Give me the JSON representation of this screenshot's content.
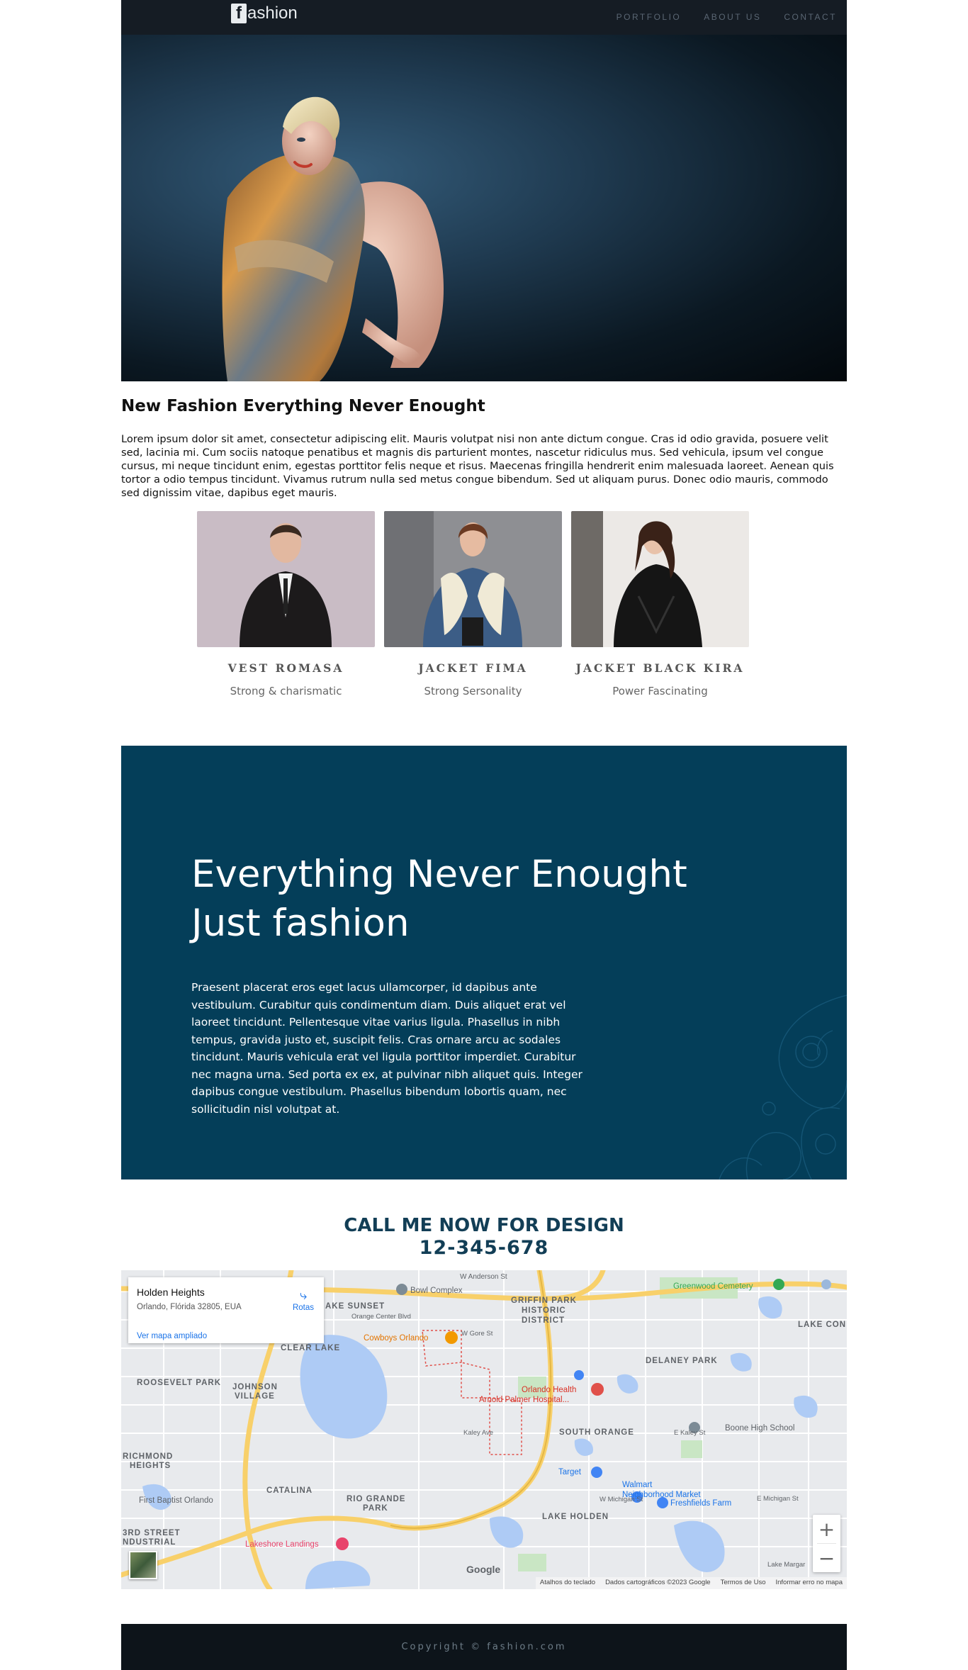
{
  "header": {
    "logo_letter": "f",
    "logo_text": "ashion",
    "nav": [
      {
        "label": "PORTFOLIO"
      },
      {
        "label": "ABOUT US"
      },
      {
        "label": "CONTACT"
      }
    ]
  },
  "intro": {
    "title": "New Fashion Everything Never Enought",
    "text": "Lorem ipsum dolor sit amet, consectetur adipiscing elit. Mauris volutpat nisi non ante dictum congue. Cras id odio gravida, posuere velit sed, lacinia mi. Cum sociis natoque penatibus et magnis dis parturient montes, nascetur ridiculus mus. Sed vehicula, ipsum vel congue cursus, mi neque tincidunt enim, egestas porttitor felis neque et risus. Maecenas fringilla hendrerit enim malesuada laoreet. Aenean quis tortor a odio tempus tincidunt. Vivamus rutrum nulla sed metus congue bibendum. Sed ut aliquam purus. Donec odio mauris, commodo sed dignissim vitae, dapibus eget mauris."
  },
  "products": [
    {
      "name": "VEST ROMASA",
      "desc": "Strong & charismatic"
    },
    {
      "name": "JACKET FIMA",
      "desc": "Strong Sersonality"
    },
    {
      "name": "JACKET BLACK KIRA",
      "desc": "Power Fascinating"
    }
  ],
  "feature": {
    "title_line1": "Everything Never Enought",
    "title_line2": "Just fashion",
    "text": "Praesent placerat eros eget lacus ullamcorper, id dapibus ante vestibulum. Curabitur quis condimentum diam. Duis aliquet erat vel laoreet tincidunt. Pellentesque vitae varius ligula. Phasellus in nibh tempus, gravida justo et, suscipit felis. Cras ornare arcu ac sodales tincidunt. Mauris vehicula erat vel ligula porttitor imperdiet. Curabitur nec magna urna. Sed porta ex ex, at pulvinar nibh aliquet quis. Integer dapibus congue vestibulum. Phasellus bibendum lobortis quam, nec sollicitudin nisl volutpat at."
  },
  "call": {
    "line1": "CALL ME NOW FOR DESIGN",
    "phone": "12-345-678"
  },
  "map": {
    "place_name": "Holden Heights",
    "address": "Orlando, Flórida 32805, EUA",
    "route_label": "Rotas",
    "larger_map_link": "Ver mapa ampliado",
    "zoom_in": "+",
    "zoom_out": "−",
    "google_label": "Google",
    "attribution": [
      "Atalhos do teclado",
      "Dados cartográficos ©2023 Google",
      "Termos de Uso",
      "Informar erro no mapa"
    ],
    "labels": [
      {
        "text": "Bowl Complex"
      },
      {
        "text": "W Anderson St"
      },
      {
        "text": "AKE SUNSET"
      },
      {
        "text": "Orange Center Blvd"
      },
      {
        "text": "GRIFFIN PARK"
      },
      {
        "text": "HISTORIC"
      },
      {
        "text": "DISTRICT"
      },
      {
        "text": "Greenwood Cemetery"
      },
      {
        "text": "LAKE CON"
      },
      {
        "text": "Cowboys Orlando"
      },
      {
        "text": "W Gore St"
      },
      {
        "text": "CLEAR LAKE"
      },
      {
        "text": "DELANEY PARK"
      },
      {
        "text": "ROOSEVELT PARK"
      },
      {
        "text": "JOHNSON"
      },
      {
        "text": "VILLAGE"
      },
      {
        "text": "Orlando Health"
      },
      {
        "text": "Arnold Palmer Hospital..."
      },
      {
        "text": "SOUTH ORANGE"
      },
      {
        "text": "Boone High School"
      },
      {
        "text": "RICHMOND"
      },
      {
        "text": "HEIGHTS"
      },
      {
        "text": "Target"
      },
      {
        "text": "Walmart"
      },
      {
        "text": "Neighborhood Market"
      },
      {
        "text": "CATALINA"
      },
      {
        "text": "First Baptist Orlando"
      },
      {
        "text": "RIO GRANDE"
      },
      {
        "text": "PARK"
      },
      {
        "text": "Freshfields Farm"
      },
      {
        "text": "LAKE HOLDEN"
      },
      {
        "text": "3RD STREET"
      },
      {
        "text": "NDUSTRIAL"
      },
      {
        "text": "Lakeshore Landings"
      },
      {
        "text": "Lake Margar"
      },
      {
        "text": "Kaley Ave"
      },
      {
        "text": "W Michigan St"
      },
      {
        "text": "E Michigan St"
      },
      {
        "text": "E Kaley St"
      }
    ]
  },
  "footer": {
    "copyright": "Copyright © fashion.com"
  }
}
